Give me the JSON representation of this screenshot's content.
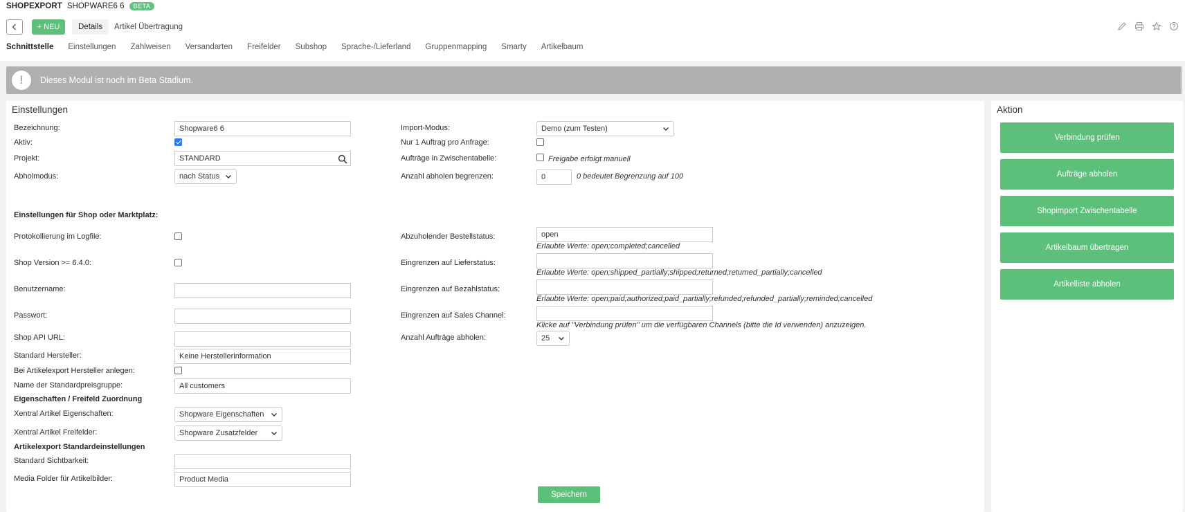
{
  "header": {
    "app_title": "SHOPEXPORT",
    "app_sub": "SHOPWARE6 6",
    "badge": "BETA",
    "new_button": "+ NEU",
    "tabs": [
      {
        "label": "Details"
      },
      {
        "label": "Artikel Übertragung"
      }
    ],
    "icons": [
      "edit-icon",
      "print-icon",
      "star-icon",
      "help-icon"
    ]
  },
  "subnav": {
    "items": [
      {
        "label": "Schnittstelle"
      },
      {
        "label": "Einstellungen"
      },
      {
        "label": "Zahlweisen"
      },
      {
        "label": "Versandarten"
      },
      {
        "label": "Freifelder"
      },
      {
        "label": "Subshop"
      },
      {
        "label": "Sprache-/Lieferland"
      },
      {
        "label": "Gruppenmapping"
      },
      {
        "label": "Smarty"
      },
      {
        "label": "Artikelbaum"
      }
    ]
  },
  "banner": {
    "icon": "!",
    "text": "Dieses Modul ist noch im Beta Stadium."
  },
  "settings": {
    "title": "Einstellungen",
    "bezeichnung_label": "Bezeichnung:",
    "bezeichnung_value": "Shopware6 6",
    "aktiv_label": "Aktiv:",
    "aktiv_checked": true,
    "projekt_label": "Projekt:",
    "projekt_value": "STANDARD",
    "abholmodus_label": "Abholmodus:",
    "abholmodus_value": "nach Status",
    "import_label": "Import-Modus:",
    "import_value": "Demo (zum Testen)",
    "nur1_label": "Nur 1 Auftrag pro Anfrage:",
    "zwischen_label": "Aufträge in Zwischentabelle:",
    "zwischen_hint": "Freigabe erfolgt manuell",
    "anzahl_begrenzen_label": "Anzahl abholen begrenzen:",
    "anzahl_begrenzen_value": "0",
    "anzahl_begrenzen_hint": "0 bedeutet Begrenzung auf 100",
    "shop_section": "Einstellungen für Shop oder Marktplatz:",
    "protokoll_label": "Protokollierung im Logfile:",
    "shopversion_label": "Shop Version >= 6.4.0:",
    "benutzer_label": "Benutzername:",
    "passwort_label": "Passwort:",
    "apiurl_label": "Shop API URL:",
    "hersteller_label": "Standard Hersteller:",
    "hersteller_value": "Keine Herstellerinformation",
    "hersteller_anlegen_label": "Bei Artikelexport Hersteller anlegen:",
    "preisgruppe_label": "Name der Standardpreisgruppe:",
    "preisgruppe_value": "All customers",
    "eigen_section": "Eigenschaften / Freifeld Zuordnung",
    "xeigen_label": "Xentral Artikel Eigenschaften:",
    "xeigen_value": "Shopware Eigenschaften",
    "xfrei_label": "Xentral Artikel Freifelder:",
    "xfrei_value": "Shopware Zusatzfelder",
    "export_section": "Artikelexport Standardeinstellungen",
    "sicht_label": "Standard Sichtbarkeit:",
    "media_label": "Media Folder für Artikelbilder:",
    "media_value": "Product Media",
    "bestell_label": "Abzuholender Bestellstatus:",
    "bestell_value": "open",
    "bestell_hint": "Erlaubte Werte: open;completed;cancelled",
    "liefer_label": "Eingrenzen auf Lieferstatus:",
    "liefer_hint": "Erlaubte Werte: open;shipped_partially;shipped;returned;returned_partially;cancelled",
    "bezahl_label": "Eingrenzen auf Bezahlstatus:",
    "bezahl_hint": "Erlaubte Werte: open;paid;authorized;paid_partially;refunded;refunded_partially;reminded;cancelled",
    "sales_label": "Eingrenzen auf Sales Channel:",
    "sales_hint": "Klicke auf \"Verbindung prüfen\" um die verfügbaren Channels (bitte die Id verwenden) anzuzeigen.",
    "anzahl_label": "Anzahl Aufträge abholen:",
    "anzahl_value": "25",
    "save_label": "Speichern"
  },
  "aktion": {
    "title": "Aktion",
    "buttons": [
      {
        "label": "Verbindung prüfen"
      },
      {
        "label": "Aufträge abholen"
      },
      {
        "label": "Shopimport Zwischentabelle"
      },
      {
        "label": "Artikelbaum übertragen"
      },
      {
        "label": "Artikelliste abholen"
      }
    ]
  },
  "colors": {
    "accent_green": "#5cc07b",
    "banner_grey": "#b0b0b0",
    "checkbox_blue": "#2b7de9"
  }
}
